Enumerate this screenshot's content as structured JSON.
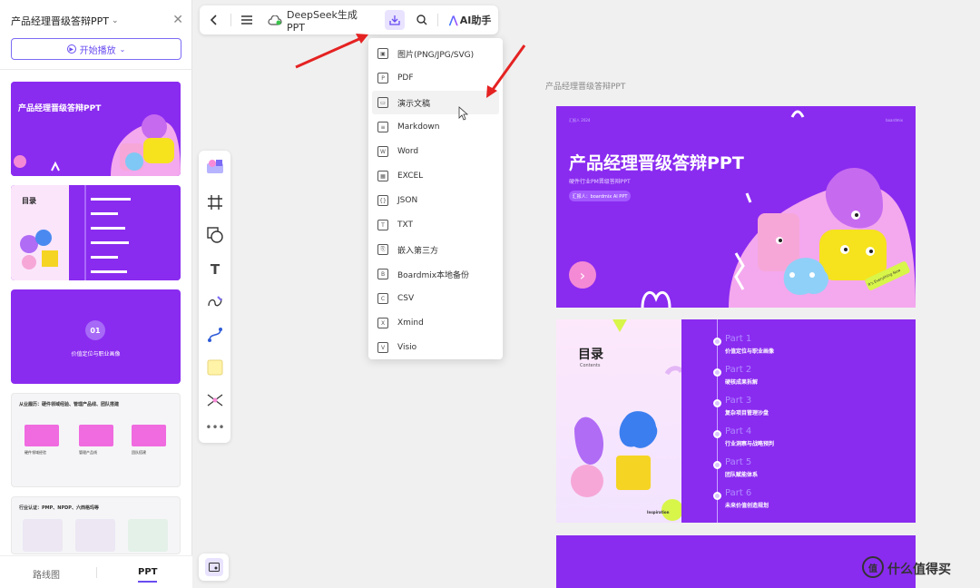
{
  "sidebar": {
    "doc_title": "产品经理晋级答辩PPT",
    "play_label": "开始播放",
    "thumbs": [
      {
        "title": "产品经理晋级答辩PPT"
      },
      {
        "title": "目录"
      },
      {
        "number": "01",
        "caption": "价值定位与职业画像"
      },
      {
        "title": "从业履历：硬件领域经验、管理产品线、团队搭建",
        "cards": [
          "硬件领域经验",
          "管理产品线",
          "团队搭建"
        ]
      },
      {
        "title": "行业认证：PMP、NPDP、六西格玛等"
      }
    ],
    "tabs": {
      "route": "路线图",
      "ppt": "PPT"
    }
  },
  "toolbar": {
    "title": "DeepSeek生成PPT",
    "ai_label": "AI助手"
  },
  "export_menu": {
    "items": [
      {
        "label": "图片(PNG/JPG/SVG)",
        "icon": "image-icon"
      },
      {
        "label": "PDF",
        "icon": "pdf-icon"
      },
      {
        "label": "演示文稿",
        "icon": "presentation-icon",
        "highlighted": true
      },
      {
        "label": "Markdown",
        "icon": "markdown-icon"
      },
      {
        "label": "Word",
        "icon": "word-icon"
      },
      {
        "label": "EXCEL",
        "icon": "excel-icon"
      },
      {
        "label": "JSON",
        "icon": "json-icon"
      },
      {
        "label": "TXT",
        "icon": "txt-icon"
      },
      {
        "label": "嵌入第三方",
        "icon": "embed-icon"
      },
      {
        "label": "Boardmix本地备份",
        "icon": "backup-icon"
      },
      {
        "label": "CSV",
        "icon": "csv-icon"
      },
      {
        "label": "Xmind",
        "icon": "xmind-icon"
      },
      {
        "label": "Visio",
        "icon": "visio-icon"
      }
    ]
  },
  "canvas": {
    "frame_label": "产品经理晋级答辩PPT",
    "slide1": {
      "title": "产品经理晋级答辩PPT",
      "subtitle": "硬件行业PM晋级答辩PPT",
      "badge": "汇报人：boardmix AI PPT",
      "top_left": "汇报人 2024",
      "top_right": "boardmix",
      "sticker": "It's Everything Now"
    },
    "slide2": {
      "title": "目录",
      "subtitle": "Contents",
      "inspiration": "Inspiration",
      "parts": [
        {
          "part": "Part 1",
          "desc": "价值定位与职业画像"
        },
        {
          "part": "Part 2",
          "desc": "硬核成果拆解"
        },
        {
          "part": "Part 3",
          "desc": "复杂项目管理沙盘"
        },
        {
          "part": "Part 4",
          "desc": "行业洞察与战略预判"
        },
        {
          "part": "Part 5",
          "desc": "团队赋能体系"
        },
        {
          "part": "Part 6",
          "desc": "未来价值创造规划"
        }
      ]
    }
  },
  "watermark": {
    "text": "什么值得买",
    "logo": "值"
  },
  "colors": {
    "accent": "#6a4cf0",
    "slide_purple": "#8a2bf0",
    "arrow_red": "#e52222"
  }
}
